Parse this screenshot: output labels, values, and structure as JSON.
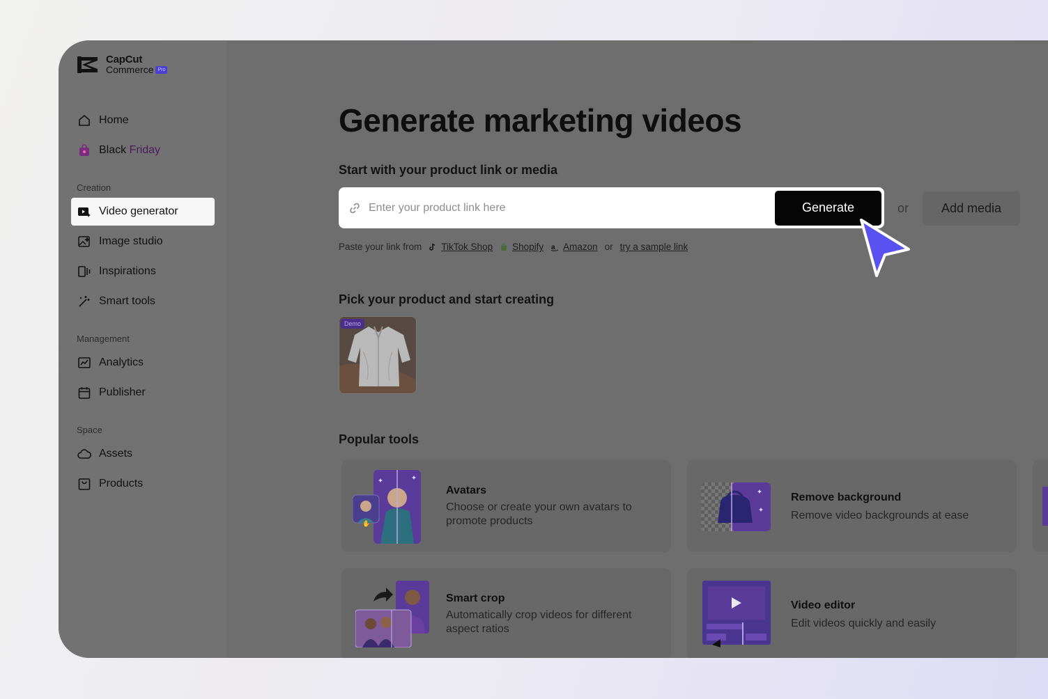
{
  "brand": {
    "name_line1": "CapCut",
    "name_line2": "Commerce",
    "badge": "Pro"
  },
  "sidebar": {
    "items_top": [
      {
        "label": "Home",
        "icon": "home-icon"
      },
      {
        "label_a": "Black ",
        "label_b": "Friday",
        "icon": "shopping-bag-icon"
      }
    ],
    "sections": {
      "creation": "Creation",
      "management": "Management",
      "space": "Space"
    },
    "creation_items": [
      {
        "label": "Video generator",
        "icon": "video-sparkle-icon",
        "active": true
      },
      {
        "label": "Image studio",
        "icon": "image-sparkle-icon"
      },
      {
        "label": "Inspirations",
        "icon": "inspirations-icon"
      },
      {
        "label": "Smart tools",
        "icon": "magic-wand-icon"
      }
    ],
    "management_items": [
      {
        "label": "Analytics",
        "icon": "analytics-icon"
      },
      {
        "label": "Publisher",
        "icon": "calendar-icon"
      }
    ],
    "space_items": [
      {
        "label": "Assets",
        "icon": "cloud-icon"
      },
      {
        "label": "Products",
        "icon": "product-box-icon"
      }
    ]
  },
  "main": {
    "title": "Generate marketing videos",
    "start_heading": "Start with your product link or media",
    "link_input": {
      "placeholder": "Enter your product link here",
      "value": ""
    },
    "generate_label": "Generate",
    "or_label": "or",
    "add_media_label": "Add media",
    "paste": {
      "prefix": "Paste your link from",
      "tiktok": "TikTok Shop",
      "shopify": "Shopify",
      "amazon": "Amazon",
      "or": "or",
      "sample": "try a sample link"
    },
    "pick_heading": "Pick your product and start creating",
    "demo_badge": "Demo",
    "popular_heading": "Popular tools",
    "tools": [
      {
        "title": "Avatars",
        "desc": "Choose or create your own avatars to promote products"
      },
      {
        "title": "Remove background",
        "desc": "Remove video backgrounds at ease"
      },
      {
        "title": "Smart crop",
        "desc": "Automatically crop videos for different aspect ratios"
      },
      {
        "title": "Video editor",
        "desc": "Edit videos quickly and easily"
      }
    ]
  },
  "colors": {
    "accent_cursor": "#5a52f0",
    "brand_purple": "#6a3fd0",
    "overlay_gray": "#6e6e6e"
  }
}
